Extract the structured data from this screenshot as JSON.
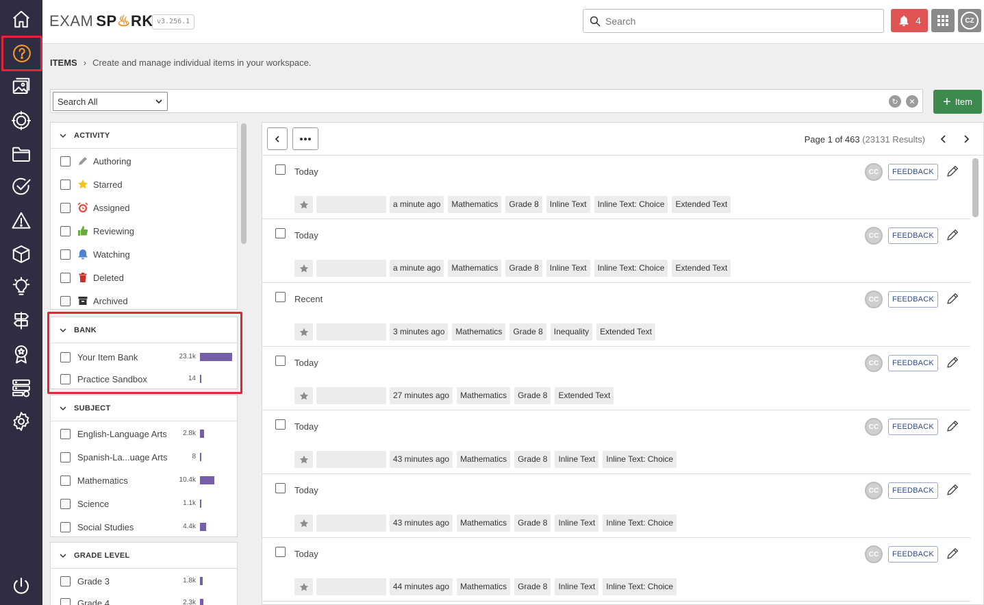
{
  "app": {
    "logo_exam": "EXAM",
    "logo_sp": "SP",
    "logo_rk": "RK",
    "version": "v3.256.1",
    "search_placeholder": "Search",
    "notifications_count": "4",
    "user_initials": "CZ"
  },
  "nav": {
    "icons": [
      "home-icon",
      "question-icon",
      "image-gallery-icon",
      "target-icon",
      "folder-icon",
      "check-circle-icon",
      "warning-icon",
      "cube-icon",
      "lightbulb-icon",
      "signpost-icon",
      "badge-icon",
      "server-icon",
      "settings-icon",
      "power-icon"
    ],
    "active": "question-icon",
    "accent_color": "#f29b2a",
    "highlight_color": "#e52535"
  },
  "breadcrumb": {
    "root": "ITEMS",
    "description": "Create and manage individual items in your workspace."
  },
  "filter": {
    "scope_selected": "Search All",
    "add_button_label": "Item"
  },
  "facets": {
    "activity": {
      "title": "ACTIVITY",
      "items": [
        {
          "label": "Authoring",
          "icon": "pencil-icon"
        },
        {
          "label": "Starred",
          "icon": "star-icon"
        },
        {
          "label": "Assigned",
          "icon": "alarm-icon"
        },
        {
          "label": "Reviewing",
          "icon": "thumbs-up-icon"
        },
        {
          "label": "Watching",
          "icon": "bell-icon"
        },
        {
          "label": "Deleted",
          "icon": "trash-icon"
        },
        {
          "label": "Archived",
          "icon": "archive-icon"
        }
      ]
    },
    "bank": {
      "title": "BANK",
      "items": [
        {
          "label": "Your Item Bank",
          "count": "23.1k",
          "fraction": 1.0
        },
        {
          "label": "Practice Sandbox",
          "count": "14",
          "fraction": 0.0
        }
      ]
    },
    "subject": {
      "title": "SUBJECT",
      "items": [
        {
          "label": "English-Language Arts",
          "count": "2.8k",
          "fraction": 0.12
        },
        {
          "label": "Spanish-La...uage Arts",
          "count": "8",
          "fraction": 0.0
        },
        {
          "label": "Mathematics",
          "count": "10.4k",
          "fraction": 0.45
        },
        {
          "label": "Science",
          "count": "1.1k",
          "fraction": 0.05
        },
        {
          "label": "Social Studies",
          "count": "4.4k",
          "fraction": 0.19
        }
      ]
    },
    "grade": {
      "title": "GRADE LEVEL",
      "items": [
        {
          "label": "Grade 3",
          "count": "1.8k",
          "fraction": 0.08
        },
        {
          "label": "Grade 4",
          "count": "2.3k",
          "fraction": 0.1
        }
      ]
    }
  },
  "results": {
    "page_label": "Page 1 of 463",
    "results_label": "(23131 Results)",
    "feedback_label": "FEEDBACK",
    "cc_label": "CC",
    "items": [
      {
        "when": "Today",
        "tags": [
          "a minute ago",
          "Mathematics",
          "Grade 8",
          "Inline Text",
          "Inline Text: Choice",
          "Extended Text"
        ]
      },
      {
        "when": "Today",
        "tags": [
          "a minute ago",
          "Mathematics",
          "Grade 8",
          "Inline Text",
          "Inline Text: Choice",
          "Extended Text"
        ]
      },
      {
        "when": "Recent",
        "tags": [
          "3 minutes ago",
          "Mathematics",
          "Grade 8",
          "Inequality",
          "Extended Text"
        ]
      },
      {
        "when": "Today",
        "tags": [
          "27 minutes ago",
          "Mathematics",
          "Grade 8",
          "Extended Text"
        ]
      },
      {
        "when": "Today",
        "tags": [
          "43 minutes ago",
          "Mathematics",
          "Grade 8",
          "Inline Text",
          "Inline Text: Choice"
        ]
      },
      {
        "when": "Today",
        "tags": [
          "43 minutes ago",
          "Mathematics",
          "Grade 8",
          "Inline Text",
          "Inline Text: Choice"
        ]
      },
      {
        "when": "Today",
        "tags": [
          "44 minutes ago",
          "Mathematics",
          "Grade 8",
          "Inline Text",
          "Inline Text: Choice"
        ]
      }
    ]
  }
}
